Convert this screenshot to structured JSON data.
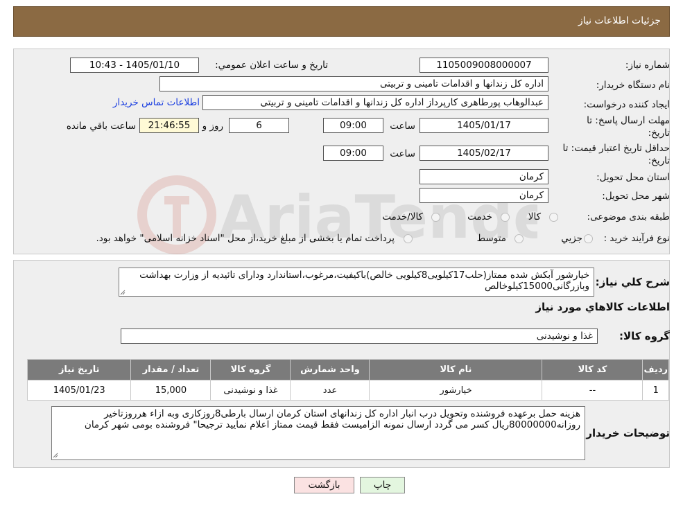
{
  "header": {
    "title": "جزئیات اطلاعات نیاز"
  },
  "form": {
    "need_number_label": "شماره نیاز:",
    "need_number": "1105009008000007",
    "announce_label": "تاریخ و ساعت اعلان عمومي:",
    "announce_value": "1405/01/10 - 10:43",
    "buyer_org_label": "نام دستگاه خریدار:",
    "buyer_org": "اداره کل زندانها و اقدامات تامینی و تربیتی",
    "creator_label": "ایجاد کننده درخواست:",
    "creator": "عبدالوهاب پورطاهری کارپرداز اداره کل زندانها و اقدامات تامینی و تربیتی",
    "contact_link": "اطلاعات تماس خریدار",
    "deadline_label_1": "مهلت ارسال پاسخ: تا",
    "deadline_label_2": "تاریخ:",
    "deadline_date": "1405/01/17",
    "time_label": "ساعت",
    "deadline_time": "09:00",
    "days_value": "6",
    "days_label": "روز و",
    "remaining_time": "21:46:55",
    "remaining_label": "ساعت باقي مانده",
    "validity_label_1": "حداقل تاریخ اعتبار قیمت: تا",
    "validity_label_2": "تاریخ:",
    "validity_date": "1405/02/17",
    "validity_time": "09:00",
    "province_label": "استان محل تحویل:",
    "province": "کرمان",
    "city_label": "شهر محل تحویل:",
    "city": "کرمان",
    "category_label": "طبقه بندی موضوعی:",
    "category_options": [
      "کالا",
      "خدمت",
      "کالا/خدمت"
    ],
    "process_label": "نوع فرآیند خرید :",
    "process_options": [
      "جزیي",
      "متوسط"
    ],
    "process_note": "پرداخت تمام یا بخشی از مبلغ خرید،از محل \"اسناد خزانه اسلامی\" خواهد بود."
  },
  "details": {
    "summary_label": "شرح کلي نیاز:",
    "summary_text": "خیارشور آبکش شده ممتاز(حلب17کیلویی8کیلویی خالص)باکیفیت،مرغوب،استاندارد ودارای تائیدیه از وزارت بهداشت وبازرگانی15000کیلوخالص",
    "goods_info_title": "اطلاعات کالاهاي مورد نیاز",
    "goods_group_label": "گروه کالا:",
    "goods_group": "غذا و نوشیدنی",
    "table": {
      "headers": [
        "ردیف",
        "کد کالا",
        "نام کالا",
        "واحد شمارش",
        "گروه کالا",
        "تعداد / مقدار",
        "تاریخ نیاز"
      ],
      "rows": [
        [
          "1",
          "--",
          "خیارشور",
          "عدد",
          "غذا و نوشیدنی",
          "15,000",
          "1405/01/23"
        ]
      ]
    },
    "buyer_notes_label": "توضیحات خریدار:",
    "buyer_notes": "هزینه حمل برعهده فروشنده وتحویل درب انبار اداره کل زندانهای استان کرمان ارسال بارطی8روزکاری وبه ازاء هرروزتاخیر روزانه80000000ریال کسر می گردد ارسال نمونه الزامیست فقط قیمت ممتاز اعلام نمایید ترجیحا\" فروشنده بومی شهر کرمان"
  },
  "buttons": {
    "print": "چاپ",
    "back": "بازگشت"
  },
  "watermark": {
    "text": "AriaTender.neT"
  },
  "colors": {
    "header_bg": "#8b6a43",
    "panel_bg": "#efefef",
    "table_header": "#7b7b7b",
    "link": "#1a3ee0"
  }
}
